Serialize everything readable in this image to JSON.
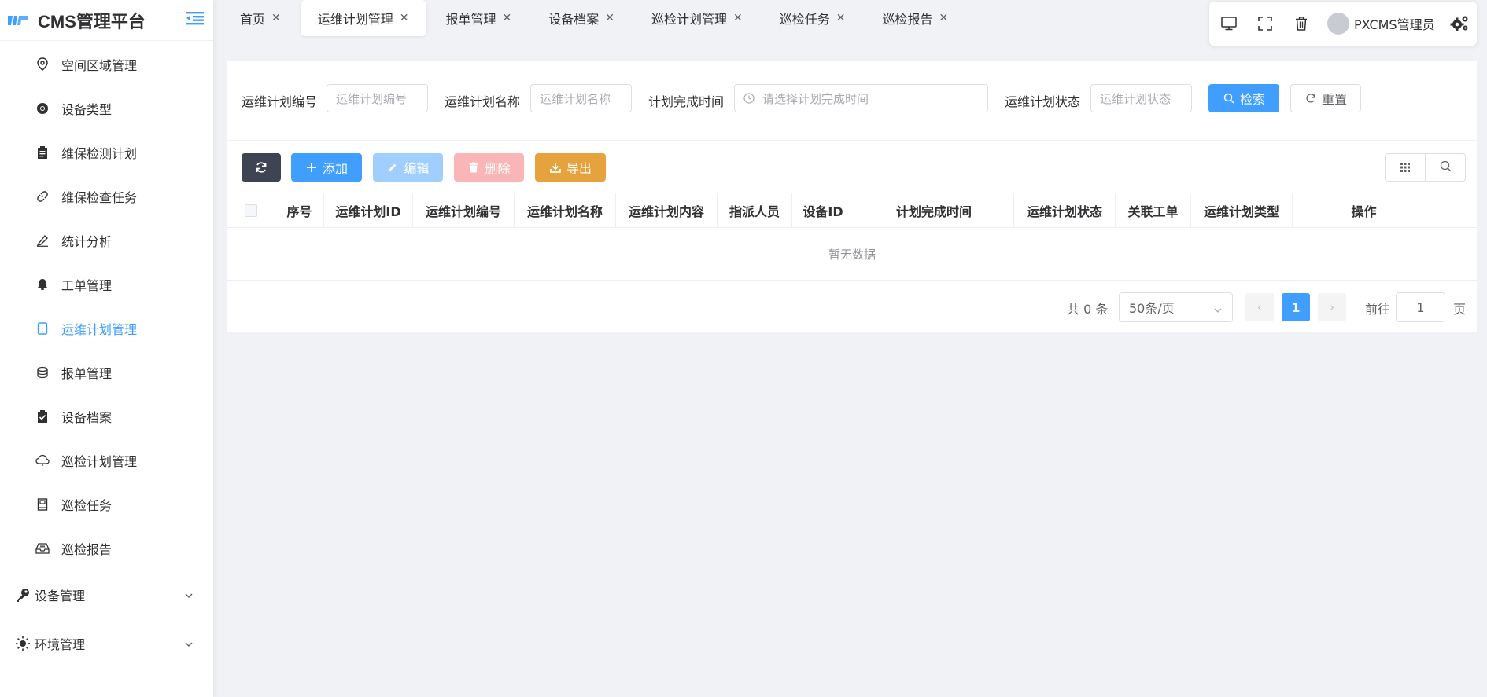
{
  "app": {
    "title": "CMS管理平台"
  },
  "sidebar": {
    "items": [
      {
        "label": "空间区域管理",
        "icon": "location-pin-icon"
      },
      {
        "label": "设备类型",
        "icon": "chrome-icon"
      },
      {
        "label": "维保检测计划",
        "icon": "clipboard-icon"
      },
      {
        "label": "维保检查任务",
        "icon": "link-icon"
      },
      {
        "label": "统计分析",
        "icon": "edit-pen-icon"
      },
      {
        "label": "工单管理",
        "icon": "bell-icon"
      },
      {
        "label": "运维计划管理",
        "icon": "tablet-icon"
      },
      {
        "label": "报单管理",
        "icon": "coin-stack-icon"
      },
      {
        "label": "设备档案",
        "icon": "checked-clipboard-icon"
      },
      {
        "label": "巡检计划管理",
        "icon": "cloud-icon"
      },
      {
        "label": "巡检任务",
        "icon": "notebook-icon"
      },
      {
        "label": "巡检报告",
        "icon": "inbox-icon"
      }
    ],
    "groups": [
      {
        "label": "设备管理",
        "icon": "key-icon"
      },
      {
        "label": "环境管理",
        "icon": "sun-icon"
      }
    ]
  },
  "tabs": [
    {
      "label": "首页"
    },
    {
      "label": "运维计划管理"
    },
    {
      "label": "报单管理"
    },
    {
      "label": "设备档案"
    },
    {
      "label": "巡检计划管理"
    },
    {
      "label": "巡检任务"
    },
    {
      "label": "巡检报告"
    }
  ],
  "topbar": {
    "user_name": "PXCMS管理员"
  },
  "search": {
    "code_label": "运维计划编号",
    "code_placeholder": "运维计划编号",
    "name_label": "运维计划名称",
    "name_placeholder": "运维计划名称",
    "time_label": "计划完成时间",
    "time_placeholder": "请选择计划完成时间",
    "status_label": "运维计划状态",
    "status_placeholder": "运维计划状态",
    "search_button": "检索",
    "reset_button": "重置"
  },
  "actions": {
    "add": "添加",
    "edit": "编辑",
    "delete": "删除",
    "export": "导出"
  },
  "table": {
    "columns": [
      "序号",
      "运维计划ID",
      "运维计划编号",
      "运维计划名称",
      "运维计划内容",
      "指派人员",
      "设备ID",
      "计划完成时间",
      "运维计划状态",
      "关联工单",
      "运维计划类型",
      "操作"
    ],
    "empty_text": "暂无数据"
  },
  "pagination": {
    "total": "共 0 条",
    "page_size": "50条/页",
    "current_page": "1",
    "goto_label": "前往",
    "goto_value": "1",
    "page_suffix": "页"
  },
  "colors": {
    "accent": "#409eff",
    "dark": "#3e4452",
    "warning": "#e6a23c",
    "danger_disabled": "#fab6b6"
  }
}
